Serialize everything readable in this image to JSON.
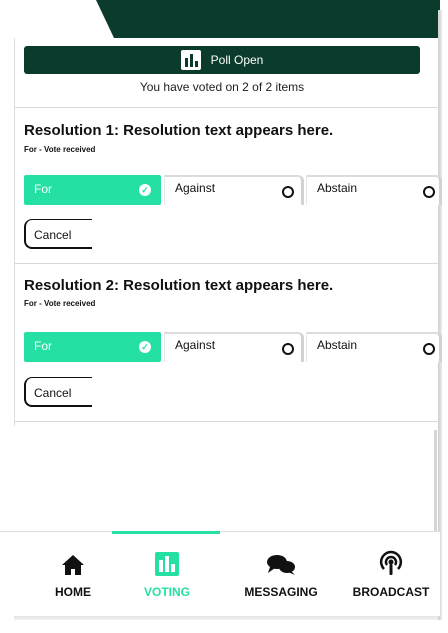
{
  "poll": {
    "status": "Poll Open",
    "summary": "You have voted on 2 of 2 items"
  },
  "resolutions": [
    {
      "title": "Resolution 1: Resolution text appears here.",
      "status": "For - Vote received",
      "options": [
        "For",
        "Against",
        "Abstain"
      ],
      "selected": "For",
      "cancel_label": "Cancel"
    },
    {
      "title": "Resolution 2: Resolution text appears here.",
      "status": "For - Vote received",
      "options": [
        "For",
        "Against",
        "Abstain"
      ],
      "selected": "For",
      "cancel_label": "Cancel"
    }
  ],
  "nav": {
    "active": "VOTING",
    "items": [
      {
        "label": "HOME",
        "icon": "home-icon"
      },
      {
        "label": "VOTING",
        "icon": "bar-chart-icon"
      },
      {
        "label": "MESSAGING",
        "icon": "chat-bubbles-icon"
      },
      {
        "label": "BROADCAST",
        "icon": "podcast-icon"
      }
    ]
  },
  "colors": {
    "brand_dark": "#0b3b2c",
    "accent": "#24e0a4"
  }
}
